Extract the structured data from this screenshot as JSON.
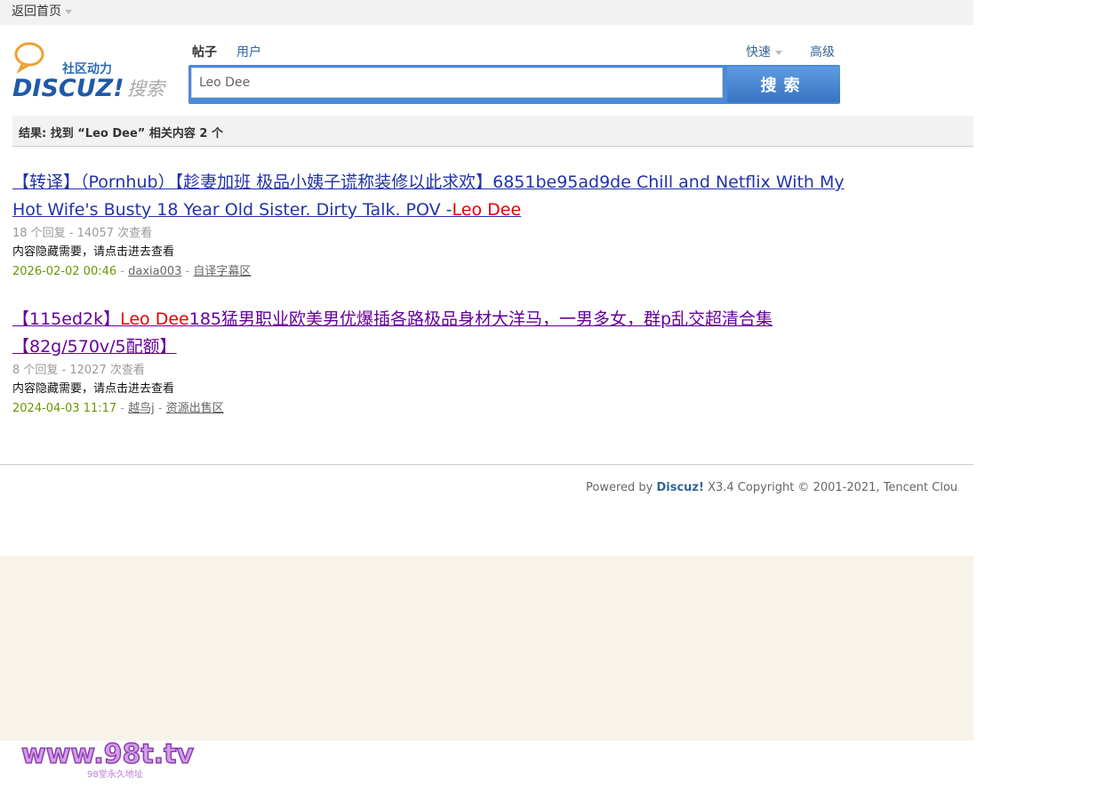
{
  "topbar": {
    "home_label": "返回首页"
  },
  "logo": {
    "slogan": "社区动力",
    "brand": "DISCUZ!",
    "suffix": "搜索"
  },
  "search": {
    "tabs": [
      {
        "label": "帖子",
        "active": true
      },
      {
        "label": "用户",
        "active": false
      }
    ],
    "quick_label": "快速",
    "advanced_label": "高级",
    "query": "Leo Dee",
    "button_label": "搜索"
  },
  "result_summary": "结果: 找到 “Leo Dee” 相关内容 2 个",
  "results": [
    {
      "title_line1": "【转译】（Pornhub）【趁妻加班 极品小姨子谎称装修以此求欢】6851be95ad9de Chill and Netflix With My",
      "title_line2_prefix": "Hot Wife's Busty 18 Year Old Sister. Dirty Talk. POV -",
      "title_highlight": "Leo Dee",
      "meta": "18 个回复 - 14057 次查看",
      "desc": "内容隐藏需要，请点击进去查看",
      "date": "2026-02-02 00:46",
      "author": "daxia003",
      "forum": "自译字幕区"
    },
    {
      "title_prefix": "【115ed2k】",
      "title_highlight": "Leo Dee",
      "title_rest_line1": "185猛男职业欧美男优爆插各路极品身材大洋马，一男多女，群p乱交超清合集",
      "title_line2": "【82g/570v/5配额】",
      "meta": "8 个回复 - 12027 次查看",
      "desc": "内容隐藏需要，请点击进去查看",
      "date": "2024-04-03 11:17",
      "author": "越鸟j",
      "forum": "资源出售区"
    }
  ],
  "footer": {
    "powered_prefix": "Powered by ",
    "powered_brand": "Discuz!",
    "powered_version": " X3.4   Copyright © 2001-2021, Tencent Clou"
  },
  "watermark": {
    "text": "www.98t.tv",
    "subtext": "98堂永久地址"
  },
  "colors": {
    "link": "#336699",
    "highlight": "#e30000",
    "date": "#669900",
    "search_blue": "#4c8ad7",
    "visited": "#660099"
  }
}
